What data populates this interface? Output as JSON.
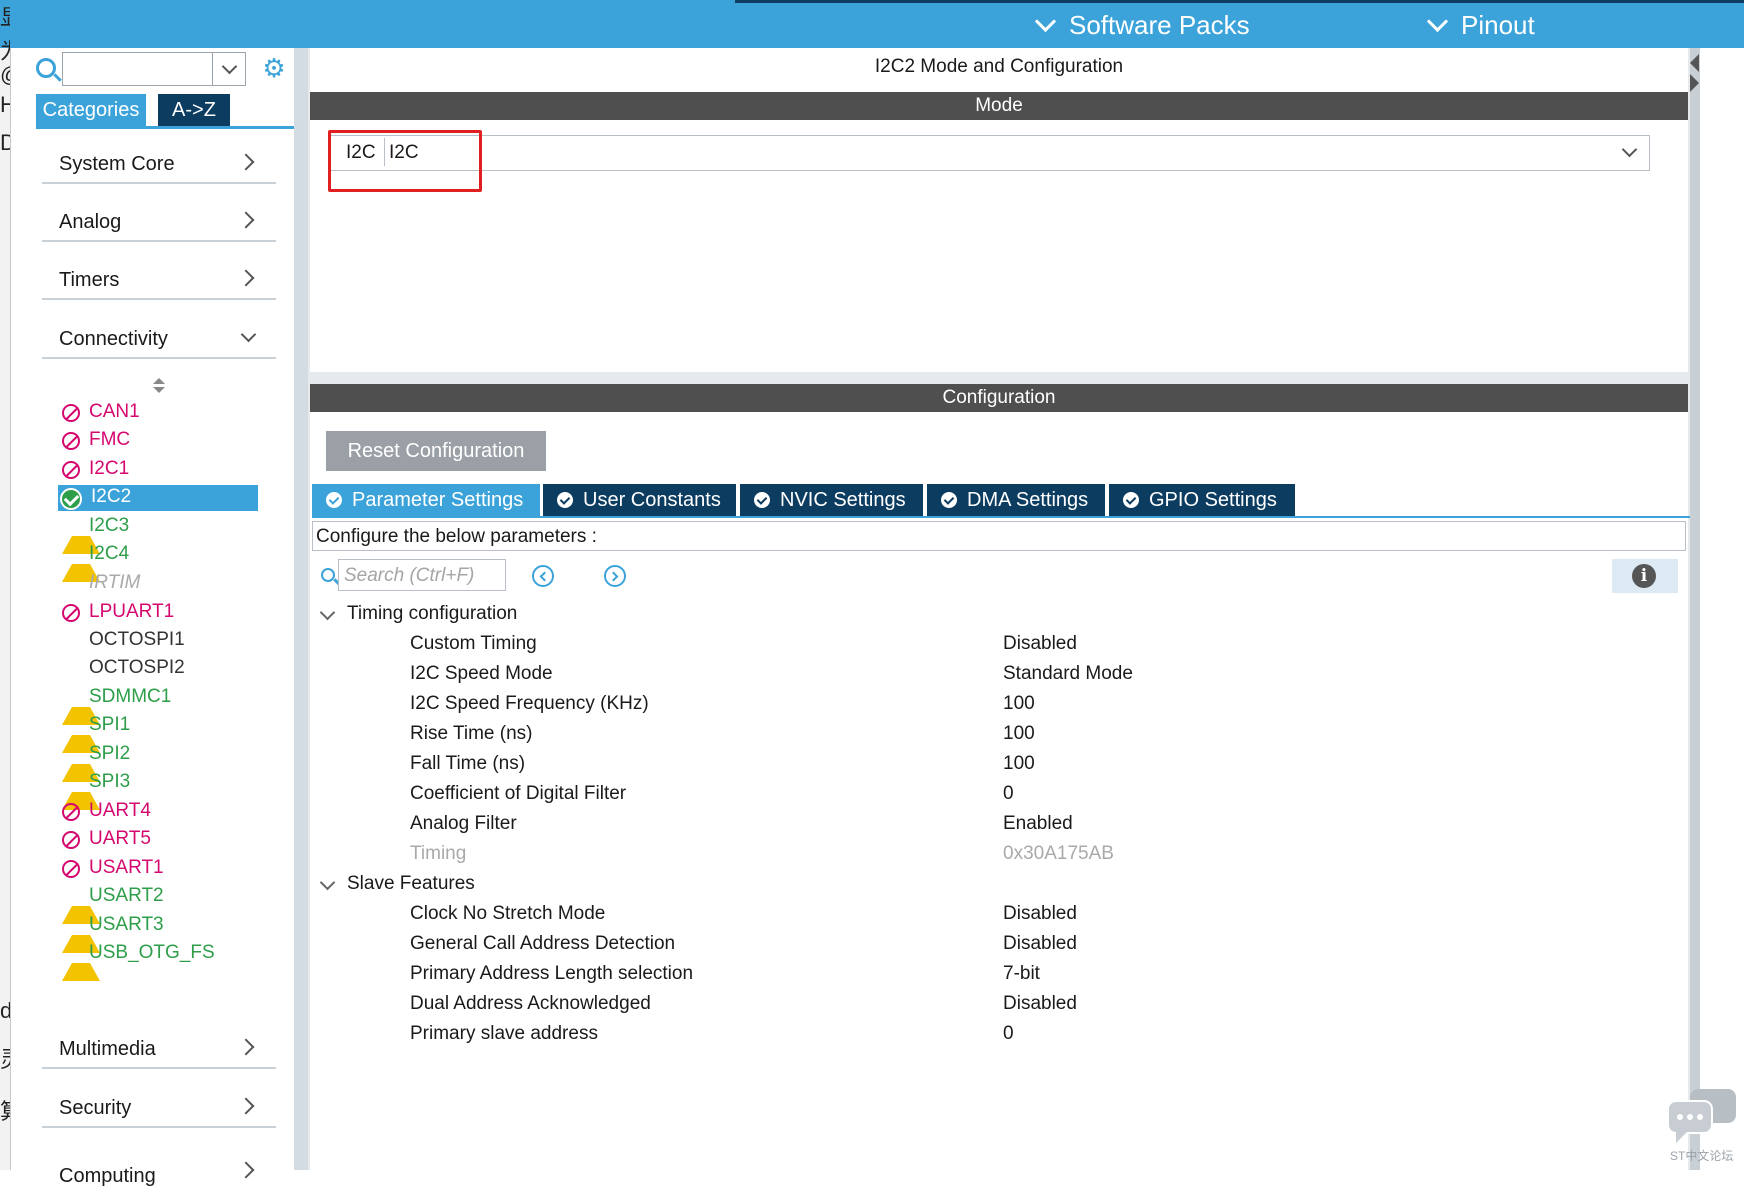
{
  "top_menu": {
    "software_packs": "Software Packs",
    "pinout": "Pinout"
  },
  "left_edge_chars": [
    "显",
    "为",
    "@",
    "H:",
    "D.",
    "di",
    "灵",
    "算"
  ],
  "sidebar": {
    "search_value": "",
    "tabs": {
      "categories": "Categories",
      "az": "A->Z"
    },
    "categories": [
      {
        "label": "System Core",
        "expanded": false
      },
      {
        "label": "Analog",
        "expanded": false
      },
      {
        "label": "Timers",
        "expanded": false
      },
      {
        "label": "Connectivity",
        "expanded": true
      }
    ],
    "peripherals": [
      {
        "name": "CAN1",
        "status": "blocked"
      },
      {
        "name": "FMC",
        "status": "blocked"
      },
      {
        "name": "I2C1",
        "status": "blocked"
      },
      {
        "name": "I2C2",
        "status": "enabled-selected"
      },
      {
        "name": "I2C3",
        "status": "warning"
      },
      {
        "name": "I2C4",
        "status": "warning"
      },
      {
        "name": "IRTIM",
        "status": "unavailable"
      },
      {
        "name": "LPUART1",
        "status": "blocked"
      },
      {
        "name": "OCTOSPI1",
        "status": "none"
      },
      {
        "name": "OCTOSPI2",
        "status": "none"
      },
      {
        "name": "SDMMC1",
        "status": "warning"
      },
      {
        "name": "SPI1",
        "status": "warning"
      },
      {
        "name": "SPI2",
        "status": "warning"
      },
      {
        "name": "SPI3",
        "status": "warning"
      },
      {
        "name": "UART4",
        "status": "blocked"
      },
      {
        "name": "UART5",
        "status": "blocked"
      },
      {
        "name": "USART1",
        "status": "blocked"
      },
      {
        "name": "USART2",
        "status": "warning"
      },
      {
        "name": "USART3",
        "status": "warning"
      },
      {
        "name": "USB_OTG_FS",
        "status": "warning"
      }
    ],
    "bottom_categories": [
      {
        "label": "Multimedia"
      },
      {
        "label": "Security"
      },
      {
        "label": "Computing"
      }
    ]
  },
  "main": {
    "title": "I2C2 Mode and Configuration",
    "mode_header": "Mode",
    "mode_label": "I2C",
    "mode_value": "I2C",
    "config_header": "Configuration",
    "reset_button": "Reset Configuration",
    "tabs": [
      {
        "label": "Parameter Settings",
        "active": true
      },
      {
        "label": "User Constants",
        "active": false
      },
      {
        "label": "NVIC Settings",
        "active": false
      },
      {
        "label": "DMA Settings",
        "active": false
      },
      {
        "label": "GPIO Settings",
        "active": false
      }
    ],
    "configure_text": "Configure the below parameters :",
    "search_placeholder": "Search (Ctrl+F)",
    "groups": [
      {
        "label": "Timing configuration",
        "params": [
          {
            "name": "Custom Timing",
            "value": "Disabled",
            "dim": false
          },
          {
            "name": "I2C Speed Mode",
            "value": "Standard Mode",
            "dim": false
          },
          {
            "name": "I2C Speed Frequency (KHz)",
            "value": "100",
            "dim": false
          },
          {
            "name": "Rise Time (ns)",
            "value": "100",
            "dim": false
          },
          {
            "name": "Fall Time (ns)",
            "value": "100",
            "dim": false
          },
          {
            "name": "Coefficient of Digital Filter",
            "value": "0",
            "dim": false
          },
          {
            "name": "Analog Filter",
            "value": "Enabled",
            "dim": false
          },
          {
            "name": "Timing",
            "value": "0x30A175AB",
            "dim": true
          }
        ]
      },
      {
        "label": "Slave Features",
        "params": [
          {
            "name": "Clock No Stretch Mode",
            "value": "Disabled",
            "dim": false
          },
          {
            "name": "General Call Address Detection",
            "value": "Disabled",
            "dim": false
          },
          {
            "name": "Primary Address Length selection",
            "value": "7-bit",
            "dim": false
          },
          {
            "name": "Dual Address Acknowledged",
            "value": "Disabled",
            "dim": false
          },
          {
            "name": "Primary slave address",
            "value": "0",
            "dim": false
          }
        ]
      }
    ]
  },
  "watermark": "ST中文论坛",
  "colors": {
    "accent": "#3ba3d9",
    "navy": "#0d3c61",
    "blocked": "#d4086f",
    "warning_text": "#2e9e4a",
    "warning_icon": "#f3c300",
    "highlight": "#e02020"
  }
}
